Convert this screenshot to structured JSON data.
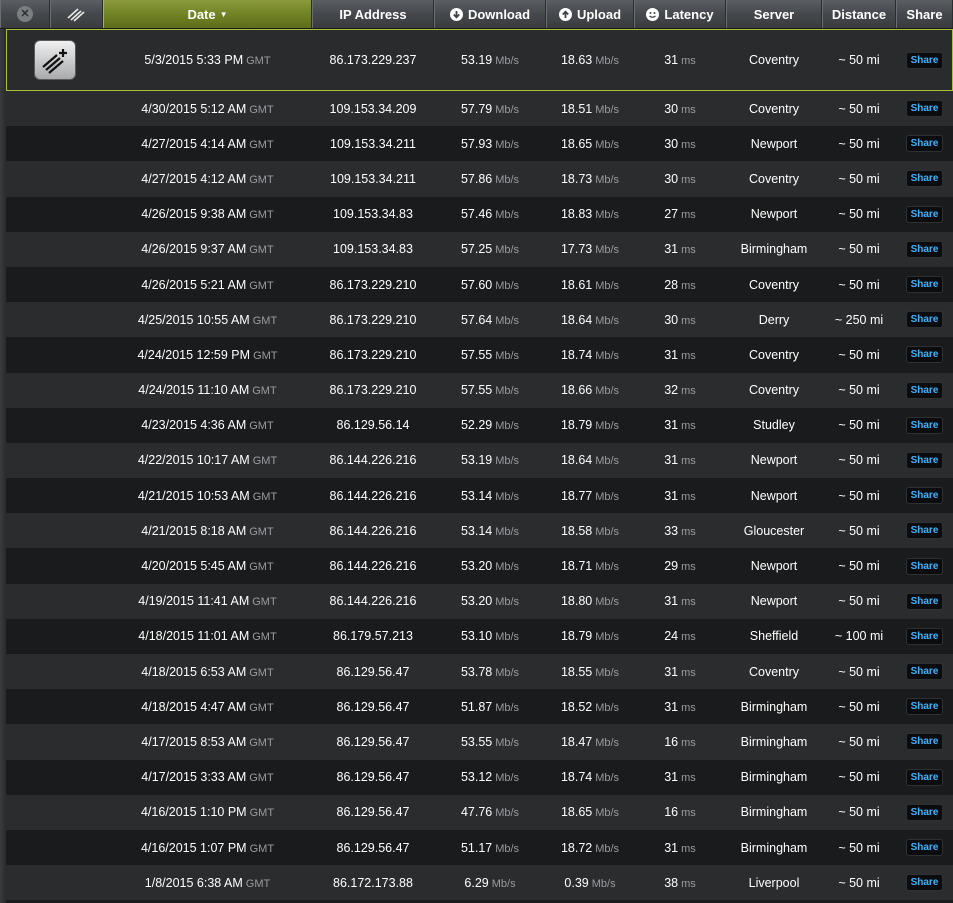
{
  "header": {
    "date": "Date",
    "ip": "IP Address",
    "download": "Download",
    "upload": "Upload",
    "latency": "Latency",
    "server": "Server",
    "distance": "Distance",
    "share": "Share",
    "date_sort_arrow": "▼",
    "close": "✕"
  },
  "colors": {
    "accent": "#a7c23a",
    "share_text": "#3fb3ff"
  },
  "tz": "GMT",
  "units": {
    "speed": "Mb/s",
    "latency": "ms"
  },
  "share_label": "Share",
  "rows": [
    {
      "date": "5/3/2015 5:33 PM",
      "ip": "86.173.229.237",
      "dl": "53.19",
      "ul": "18.63",
      "lat": "31",
      "server": "Coventry",
      "dist": "~ 50 mi"
    },
    {
      "date": "4/30/2015 5:12 AM",
      "ip": "109.153.34.209",
      "dl": "57.79",
      "ul": "18.51",
      "lat": "30",
      "server": "Coventry",
      "dist": "~ 50 mi"
    },
    {
      "date": "4/27/2015 4:14 AM",
      "ip": "109.153.34.211",
      "dl": "57.93",
      "ul": "18.65",
      "lat": "30",
      "server": "Newport",
      "dist": "~ 50 mi"
    },
    {
      "date": "4/27/2015 4:12 AM",
      "ip": "109.153.34.211",
      "dl": "57.86",
      "ul": "18.73",
      "lat": "30",
      "server": "Coventry",
      "dist": "~ 50 mi"
    },
    {
      "date": "4/26/2015 9:38 AM",
      "ip": "109.153.34.83",
      "dl": "57.46",
      "ul": "18.83",
      "lat": "27",
      "server": "Newport",
      "dist": "~ 50 mi"
    },
    {
      "date": "4/26/2015 9:37 AM",
      "ip": "109.153.34.83",
      "dl": "57.25",
      "ul": "17.73",
      "lat": "31",
      "server": "Birmingham",
      "dist": "~ 50 mi"
    },
    {
      "date": "4/26/2015 5:21 AM",
      "ip": "86.173.229.210",
      "dl": "57.60",
      "ul": "18.61",
      "lat": "28",
      "server": "Coventry",
      "dist": "~ 50 mi"
    },
    {
      "date": "4/25/2015 10:55 AM",
      "ip": "86.173.229.210",
      "dl": "57.64",
      "ul": "18.64",
      "lat": "30",
      "server": "Derry",
      "dist": "~ 250 mi"
    },
    {
      "date": "4/24/2015 12:59 PM",
      "ip": "86.173.229.210",
      "dl": "57.55",
      "ul": "18.74",
      "lat": "31",
      "server": "Coventry",
      "dist": "~ 50 mi"
    },
    {
      "date": "4/24/2015 11:10 AM",
      "ip": "86.173.229.210",
      "dl": "57.55",
      "ul": "18.66",
      "lat": "32",
      "server": "Coventry",
      "dist": "~ 50 mi"
    },
    {
      "date": "4/23/2015 4:36 AM",
      "ip": "86.129.56.14",
      "dl": "52.29",
      "ul": "18.79",
      "lat": "31",
      "server": "Studley",
      "dist": "~ 50 mi"
    },
    {
      "date": "4/22/2015 10:17 AM",
      "ip": "86.144.226.216",
      "dl": "53.19",
      "ul": "18.64",
      "lat": "31",
      "server": "Newport",
      "dist": "~ 50 mi"
    },
    {
      "date": "4/21/2015 10:53 AM",
      "ip": "86.144.226.216",
      "dl": "53.14",
      "ul": "18.77",
      "lat": "31",
      "server": "Newport",
      "dist": "~ 50 mi"
    },
    {
      "date": "4/21/2015 8:18 AM",
      "ip": "86.144.226.216",
      "dl": "53.14",
      "ul": "18.58",
      "lat": "33",
      "server": "Gloucester",
      "dist": "~ 50 mi"
    },
    {
      "date": "4/20/2015 5:45 AM",
      "ip": "86.144.226.216",
      "dl": "53.20",
      "ul": "18.71",
      "lat": "29",
      "server": "Newport",
      "dist": "~ 50 mi"
    },
    {
      "date": "4/19/2015 11:41 AM",
      "ip": "86.144.226.216",
      "dl": "53.20",
      "ul": "18.80",
      "lat": "31",
      "server": "Newport",
      "dist": "~ 50 mi"
    },
    {
      "date": "4/18/2015 11:01 AM",
      "ip": "86.179.57.213",
      "dl": "53.10",
      "ul": "18.79",
      "lat": "24",
      "server": "Sheffield",
      "dist": "~ 100 mi"
    },
    {
      "date": "4/18/2015 6:53 AM",
      "ip": "86.129.56.47",
      "dl": "53.78",
      "ul": "18.55",
      "lat": "31",
      "server": "Coventry",
      "dist": "~ 50 mi"
    },
    {
      "date": "4/18/2015 4:47 AM",
      "ip": "86.129.56.47",
      "dl": "51.87",
      "ul": "18.52",
      "lat": "31",
      "server": "Birmingham",
      "dist": "~ 50 mi"
    },
    {
      "date": "4/17/2015 8:53 AM",
      "ip": "86.129.56.47",
      "dl": "53.55",
      "ul": "18.47",
      "lat": "16",
      "server": "Birmingham",
      "dist": "~ 50 mi"
    },
    {
      "date": "4/17/2015 3:33 AM",
      "ip": "86.129.56.47",
      "dl": "53.12",
      "ul": "18.74",
      "lat": "31",
      "server": "Birmingham",
      "dist": "~ 50 mi"
    },
    {
      "date": "4/16/2015 1:10 PM",
      "ip": "86.129.56.47",
      "dl": "47.76",
      "ul": "18.65",
      "lat": "16",
      "server": "Birmingham",
      "dist": "~ 50 mi"
    },
    {
      "date": "4/16/2015 1:07 PM",
      "ip": "86.129.56.47",
      "dl": "51.17",
      "ul": "18.72",
      "lat": "31",
      "server": "Birmingham",
      "dist": "~ 50 mi"
    },
    {
      "date": "1/8/2015 6:38 AM",
      "ip": "86.172.173.88",
      "dl": "6.29",
      "ul": "0.39",
      "lat": "38",
      "server": "Liverpool",
      "dist": "~ 50 mi"
    }
  ]
}
